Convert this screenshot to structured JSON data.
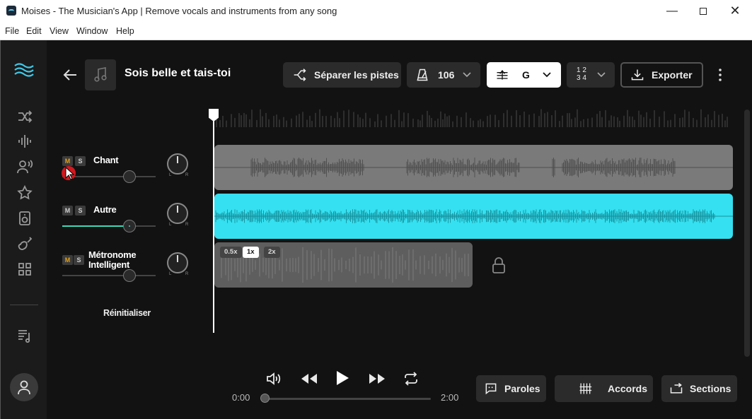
{
  "window": {
    "title": "Moises - The Musician's App | Remove vocals and instruments from any song",
    "minimize_icon": "minimize-icon",
    "maximize_icon": "maximize-icon",
    "close_icon": "close-icon"
  },
  "menu": [
    "File",
    "Edit",
    "View",
    "Window",
    "Help"
  ],
  "song": {
    "title": "Sois belle et tais-toi"
  },
  "toolbar": {
    "separate_label": "Séparer les pistes",
    "bpm": "106",
    "key": "G",
    "time_signature_top": "1 2",
    "time_signature_bottom": "3 4",
    "export_label": "Exporter"
  },
  "tracks": [
    {
      "name": "Chant",
      "mute": "M",
      "solo": "S",
      "muted": true,
      "volume": 0.72,
      "color": "#808080"
    },
    {
      "name": "Autre",
      "mute": "M",
      "solo": "S",
      "muted": false,
      "volume": 0.72,
      "color": "#35e0f0"
    },
    {
      "name": "Métronome Intelligent",
      "mute": "M",
      "solo": "S",
      "muted": false,
      "volume": 0.72,
      "color": "#6a6a6a"
    }
  ],
  "pan_labels": {
    "left": "L",
    "right": "R"
  },
  "metronome_speeds": [
    "0.5x",
    "1x",
    "2x"
  ],
  "metronome_speed_selected": "1x",
  "reset_label": "Réinitialiser",
  "transport": {
    "current_time": "0:00",
    "total_time": "2:00",
    "progress": 0.0
  },
  "bottom_buttons": {
    "lyrics_label": "Paroles",
    "chords_label": "Accords",
    "sections_label": "Sections"
  },
  "colors": {
    "accent": "#35e0f0",
    "background": "#121212",
    "rail": "#1b1b1b",
    "mute_active": "#d0191f"
  }
}
